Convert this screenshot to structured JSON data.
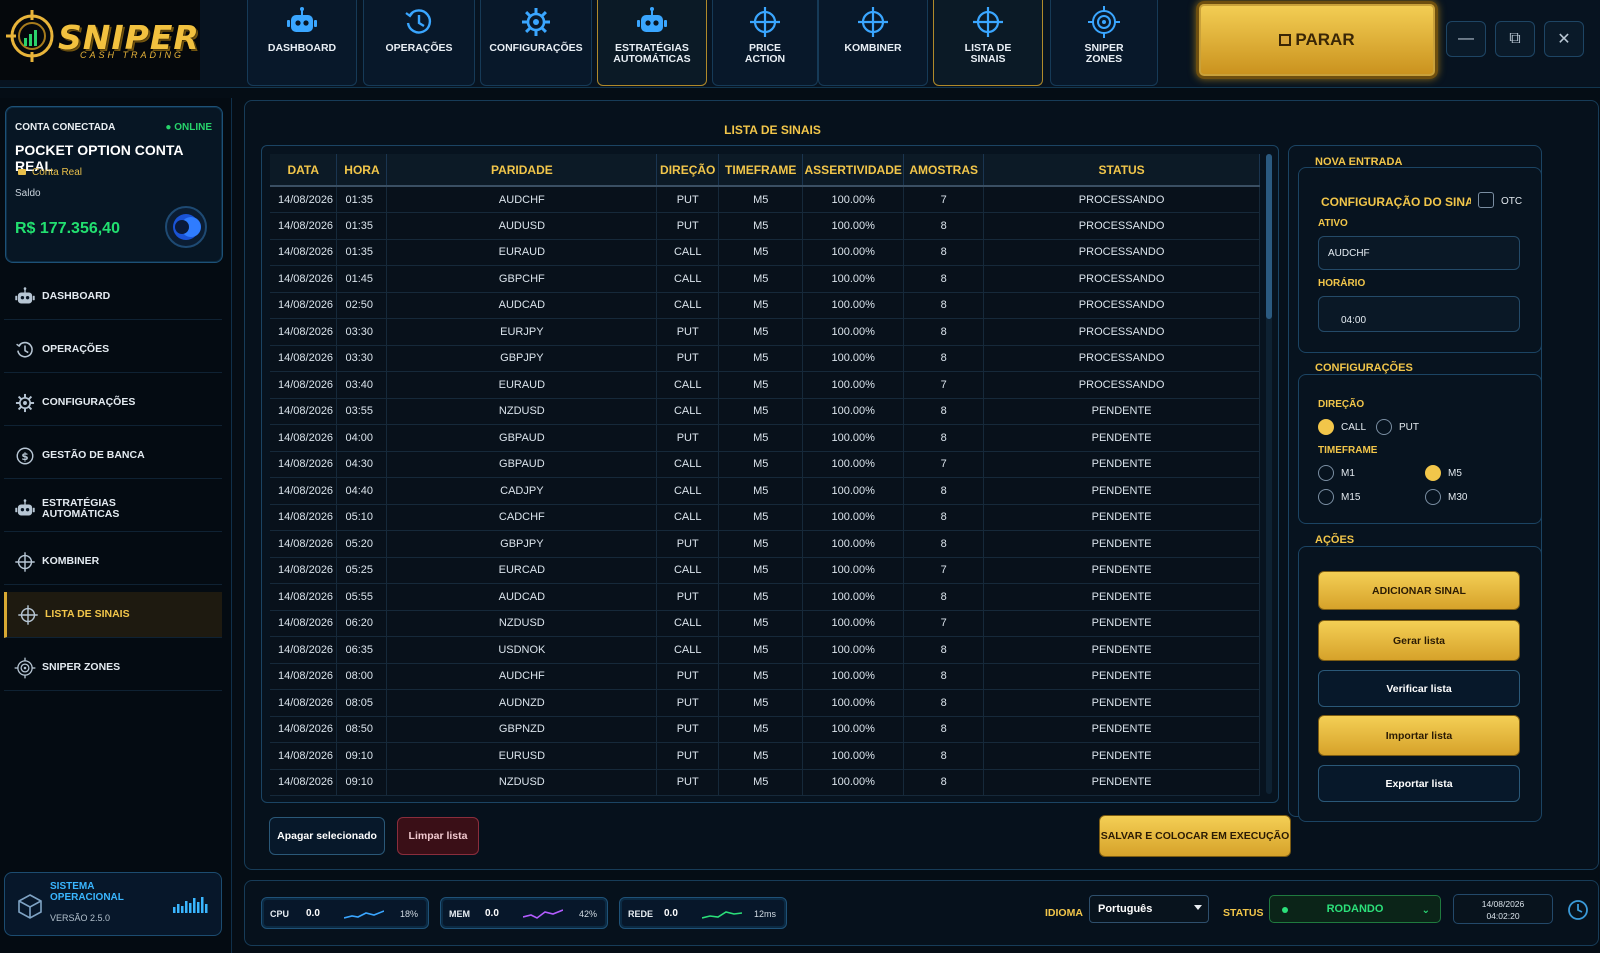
{
  "app": {
    "logo_word": "SNIPER",
    "logo_sub": "CASH TRADING"
  },
  "nav": [
    {
      "label": "DASHBOARD",
      "icon": "robot-icon"
    },
    {
      "label": "OPERAÇÕES",
      "icon": "clock-history-icon"
    },
    {
      "label": "CONFIGURAÇÕES",
      "icon": "gear-icon"
    },
    {
      "label": "ESTRATÉGIAS\nAUTOMÁTICAS",
      "icon": "robot-icon"
    },
    {
      "label": "PRICE\nACTION",
      "icon": "crosshair-icon"
    },
    {
      "label": "KOMBINER",
      "icon": "crosshair-icon"
    },
    {
      "label": "LISTA DE\nSINAIS",
      "icon": "crosshair-icon"
    },
    {
      "label": "SNIPER\nZONES",
      "icon": "target-icon"
    }
  ],
  "stop_button": "PARAR",
  "window_controls": {
    "minimize": "—",
    "restore": "⧉",
    "close": "✕"
  },
  "account": {
    "header": "CONTA CONECTADA",
    "status": "● ONLINE",
    "name": "POCKET OPTION CONTA REAL",
    "type": "Conta Real",
    "balance_label": "Saldo",
    "balance": "R$ 177.356,40"
  },
  "sidebar": [
    {
      "label": "DASHBOARD",
      "icon": "robot-icon"
    },
    {
      "label": "OPERAÇÕES",
      "icon": "clock-history-icon"
    },
    {
      "label": "CONFIGURAÇÕES",
      "icon": "gear-icon"
    },
    {
      "label": "GESTÃO DE BANCA",
      "icon": "dollar-icon"
    },
    {
      "label": "ESTRATÉGIAS\nAUTOMÁTICAS",
      "icon": "robot-icon"
    },
    {
      "label": "KOMBINER",
      "icon": "crosshair-icon"
    },
    {
      "label": "LISTA DE SINAIS",
      "icon": "crosshair-icon"
    },
    {
      "label": "SNIPER ZONES",
      "icon": "target-icon"
    }
  ],
  "system": {
    "title": "SISTEMA\nOPERACIONAL",
    "version": "VERSÃO 2.5.0"
  },
  "main": {
    "title": "LISTA DE SINAIS",
    "columns": [
      "DATA",
      "HORA",
      "PARIDADE",
      "DIREÇÃO",
      "TIMEFRAME",
      "ASSERTIVIDADE",
      "AMOSTRAS",
      "STATUS"
    ],
    "rows": [
      [
        "14/08/2026",
        "01:35",
        "AUDCHF",
        "PUT",
        "M5",
        "100.00%",
        "7",
        "PROCESSANDO"
      ],
      [
        "14/08/2026",
        "01:35",
        "AUDUSD",
        "PUT",
        "M5",
        "100.00%",
        "8",
        "PROCESSANDO"
      ],
      [
        "14/08/2026",
        "01:35",
        "EURAUD",
        "CALL",
        "M5",
        "100.00%",
        "8",
        "PROCESSANDO"
      ],
      [
        "14/08/2026",
        "01:45",
        "GBPCHF",
        "CALL",
        "M5",
        "100.00%",
        "8",
        "PROCESSANDO"
      ],
      [
        "14/08/2026",
        "02:50",
        "AUDCAD",
        "CALL",
        "M5",
        "100.00%",
        "8",
        "PROCESSANDO"
      ],
      [
        "14/08/2026",
        "03:30",
        "EURJPY",
        "PUT",
        "M5",
        "100.00%",
        "8",
        "PROCESSANDO"
      ],
      [
        "14/08/2026",
        "03:30",
        "GBPJPY",
        "PUT",
        "M5",
        "100.00%",
        "8",
        "PROCESSANDO"
      ],
      [
        "14/08/2026",
        "03:40",
        "EURAUD",
        "CALL",
        "M5",
        "100.00%",
        "7",
        "PROCESSANDO"
      ],
      [
        "14/08/2026",
        "03:55",
        "NZDUSD",
        "CALL",
        "M5",
        "100.00%",
        "8",
        "PENDENTE"
      ],
      [
        "14/08/2026",
        "04:00",
        "GBPAUD",
        "PUT",
        "M5",
        "100.00%",
        "8",
        "PENDENTE"
      ],
      [
        "14/08/2026",
        "04:30",
        "GBPAUD",
        "CALL",
        "M5",
        "100.00%",
        "7",
        "PENDENTE"
      ],
      [
        "14/08/2026",
        "04:40",
        "CADJPY",
        "CALL",
        "M5",
        "100.00%",
        "8",
        "PENDENTE"
      ],
      [
        "14/08/2026",
        "05:10",
        "CADCHF",
        "CALL",
        "M5",
        "100.00%",
        "8",
        "PENDENTE"
      ],
      [
        "14/08/2026",
        "05:20",
        "GBPJPY",
        "PUT",
        "M5",
        "100.00%",
        "8",
        "PENDENTE"
      ],
      [
        "14/08/2026",
        "05:25",
        "EURCAD",
        "CALL",
        "M5",
        "100.00%",
        "7",
        "PENDENTE"
      ],
      [
        "14/08/2026",
        "05:55",
        "AUDCAD",
        "PUT",
        "M5",
        "100.00%",
        "8",
        "PENDENTE"
      ],
      [
        "14/08/2026",
        "06:20",
        "NZDUSD",
        "CALL",
        "M5",
        "100.00%",
        "7",
        "PENDENTE"
      ],
      [
        "14/08/2026",
        "06:35",
        "USDNOK",
        "CALL",
        "M5",
        "100.00%",
        "8",
        "PENDENTE"
      ],
      [
        "14/08/2026",
        "08:00",
        "AUDCHF",
        "PUT",
        "M5",
        "100.00%",
        "8",
        "PENDENTE"
      ],
      [
        "14/08/2026",
        "08:05",
        "AUDNZD",
        "PUT",
        "M5",
        "100.00%",
        "8",
        "PENDENTE"
      ],
      [
        "14/08/2026",
        "08:50",
        "GBPNZD",
        "PUT",
        "M5",
        "100.00%",
        "8",
        "PENDENTE"
      ],
      [
        "14/08/2026",
        "09:10",
        "EURUSD",
        "PUT",
        "M5",
        "100.00%",
        "8",
        "PENDENTE"
      ],
      [
        "14/08/2026",
        "09:10",
        "NZDUSD",
        "PUT",
        "M5",
        "100.00%",
        "8",
        "PENDENTE"
      ]
    ],
    "btn_delete_selected": "Apagar selecionado",
    "btn_clear": "Limpar lista",
    "btn_save_run": "SALVAR E COLOCAR EM EXECUÇÃO"
  },
  "entry": {
    "title": "NOVA ENTRADA",
    "config_title": "CONFIGURAÇÃO DO SINAL",
    "otc_label": "OTC",
    "otc_checked": false,
    "asset_label": "ATIVO",
    "asset_value": "AUDCHF",
    "time_label": "HORÁRIO",
    "time_value": "04:00"
  },
  "config": {
    "title": "CONFIGURAÇÕES",
    "direction_label": "DIREÇÃO",
    "directions": [
      {
        "label": "CALL",
        "selected": true
      },
      {
        "label": "PUT",
        "selected": false
      }
    ],
    "timeframe_label": "TIMEFRAME",
    "timeframes": [
      {
        "label": "M1",
        "selected": false
      },
      {
        "label": "M5",
        "selected": true
      },
      {
        "label": "M15",
        "selected": false
      },
      {
        "label": "M30",
        "selected": false
      }
    ]
  },
  "actions": {
    "title": "AÇÕES",
    "add_signal": "ADICIONAR SINAL",
    "generate": "Gerar lista",
    "verify": "Verificar lista",
    "import": "Importar lista",
    "export": "Exportar lista"
  },
  "status_bar": {
    "metrics": [
      {
        "name": "CPU",
        "value": "0.0",
        "extra": "18%",
        "color": "#3aa6ff"
      },
      {
        "name": "MEM",
        "value": "0.0",
        "extra": "42%",
        "color": "#b35cff"
      },
      {
        "name": "REDE",
        "value": "0.0",
        "extra": "12ms",
        "color": "#2be07a"
      }
    ],
    "language_label": "IDIOMA",
    "language_value": "Português",
    "status_label": "STATUS",
    "status_value": "RODANDO",
    "date": "14/08/2026",
    "time": "04:02:20"
  },
  "colors": {
    "accent": "#f2c64a",
    "online": "#27d36b",
    "balance": "#22e070",
    "danger": "#8a2d3c"
  }
}
